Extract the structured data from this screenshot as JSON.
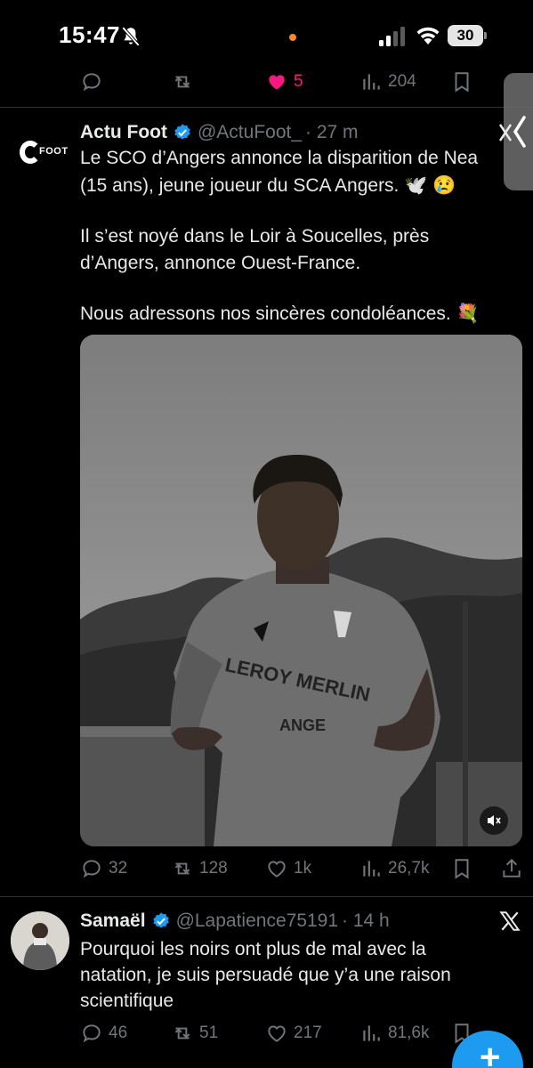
{
  "status_bar": {
    "time": "15:47",
    "battery": "30",
    "icons": [
      "bell-slash-icon",
      "signal-icon",
      "wifi-icon",
      "battery-icon"
    ],
    "dot_color": "#f28c28"
  },
  "prev_tweet_actions": {
    "likes": "5",
    "views": "204",
    "like_color": "#f91880"
  },
  "tweet1": {
    "display_name": "Actu Foot",
    "handle": "@ActuFoot_",
    "time": "· 27 m",
    "avatar_text": "FOOT",
    "lines": [
      "Le SCO d’Angers annonce la disparition de Nea",
      "(15 ans), jeune joueur du SCA Angers. 🕊️ 😢",
      "Il s’est noyé dans le Loir à Soucelles, près",
      "d’Angers, annonce Ouest-France.",
      "Nous adressons nos sincères condoléances. 💐"
    ],
    "actions": {
      "replies": "32",
      "reposts": "128",
      "likes": "1k",
      "views": "26,7k"
    }
  },
  "tweet2": {
    "display_name": "Samaël",
    "handle": "@Lapatience75191",
    "time": "· 14 h",
    "lines": [
      "Pourquoi les noirs ont plus de mal avec la",
      "natation, je suis persuadé que y’a une raison",
      "scientifique"
    ],
    "actions": {
      "replies": "46",
      "reposts": "51",
      "likes": "217",
      "views": "81,6k"
    }
  },
  "colors": {
    "background": "#000000",
    "text": "#e7e9ea",
    "muted": "#71767b",
    "verified": "#1d9bf0",
    "divider": "#2f3336"
  }
}
